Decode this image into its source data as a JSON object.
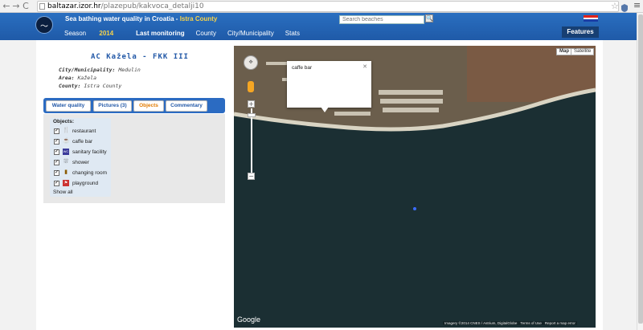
{
  "browser": {
    "url_host": "baltazar.izor.hr",
    "url_path": "/plazepub/kakvoca_detalji10"
  },
  "header": {
    "title_main": "Sea bathing water quality in Croatia - ",
    "title_county": "Istra County",
    "nav": {
      "season_label": "Season",
      "season_year": "2014",
      "last_monitoring": "Last monitoring",
      "county": "County",
      "city": "City/Municipality",
      "stats": "Stats"
    },
    "search_placeholder": "Search beaches",
    "features_label": "Features",
    "flag_colors": [
      "#e0241b",
      "#ffffff",
      "#1b3ea6"
    ]
  },
  "beach": {
    "title": "AC Kažela - FKK III",
    "city_label": "City/Municipality:",
    "city_value": "Medulin",
    "area_label": "Area:",
    "area_value": "Kažela",
    "county_label": "County:",
    "county_value": "Istra County"
  },
  "tabs": [
    {
      "label": "Water quality",
      "active": false
    },
    {
      "label": "Pictures (3)",
      "active": false
    },
    {
      "label": "Objects",
      "active": true
    },
    {
      "label": "Commentary",
      "active": false
    }
  ],
  "objects": {
    "title": "Objects:",
    "items": [
      {
        "label": "restaurant",
        "icon": "restaurant-icon",
        "checked": true
      },
      {
        "label": "caffe bar",
        "icon": "coffee-icon",
        "checked": true
      },
      {
        "label": "sanitary facility",
        "icon": "wc-icon",
        "checked": true
      },
      {
        "label": "shower",
        "icon": "shower-icon",
        "checked": true
      },
      {
        "label": "changing room",
        "icon": "changing-room-icon",
        "checked": true
      },
      {
        "label": "playground",
        "icon": "playground-icon",
        "checked": true
      }
    ],
    "show_all": "Show all"
  },
  "map": {
    "type_map": "Map",
    "type_satellite": "Satellite",
    "infowindow_text": "caffe bar",
    "google": "Google",
    "attribution": [
      "Imagery ©2014 CNES / Astrium, DigitalGlobe",
      "Terms of Use",
      "Report a map error"
    ]
  }
}
